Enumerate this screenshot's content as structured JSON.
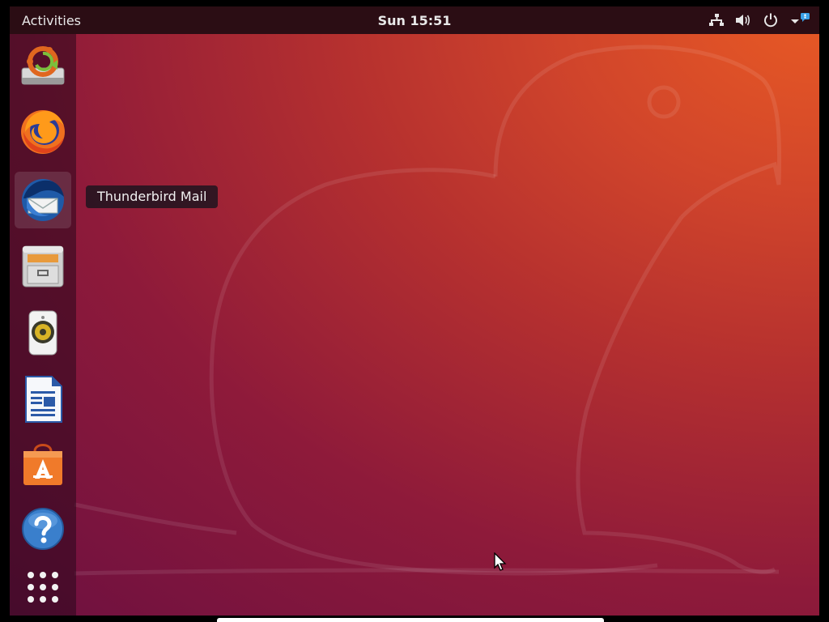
{
  "topbar": {
    "activities_label": "Activities",
    "clock": "Sun 15:51",
    "tray_icons": [
      "network-icon",
      "volume-icon",
      "power-icon",
      "menu-arrow-icon",
      "notification-icon"
    ]
  },
  "dock": {
    "items": [
      {
        "name": "software-updater",
        "icon": "software-updater-icon"
      },
      {
        "name": "firefox",
        "icon": "firefox-icon"
      },
      {
        "name": "thunderbird",
        "icon": "thunderbird-icon",
        "active": true
      },
      {
        "name": "files",
        "icon": "files-icon"
      },
      {
        "name": "rhythmbox",
        "icon": "rhythmbox-icon"
      },
      {
        "name": "libreoffice-writer",
        "icon": "writer-icon"
      },
      {
        "name": "ubuntu-software",
        "icon": "ubuntu-software-icon"
      },
      {
        "name": "help",
        "icon": "help-icon"
      },
      {
        "name": "show-applications",
        "icon": "app-grid-icon"
      }
    ]
  },
  "tooltip": {
    "text": "Thunderbird Mail"
  },
  "colors": {
    "topbar": "#2b0d14",
    "wallpaper_orange": "#e85a24",
    "wallpaper_purple": "#6d1040"
  }
}
